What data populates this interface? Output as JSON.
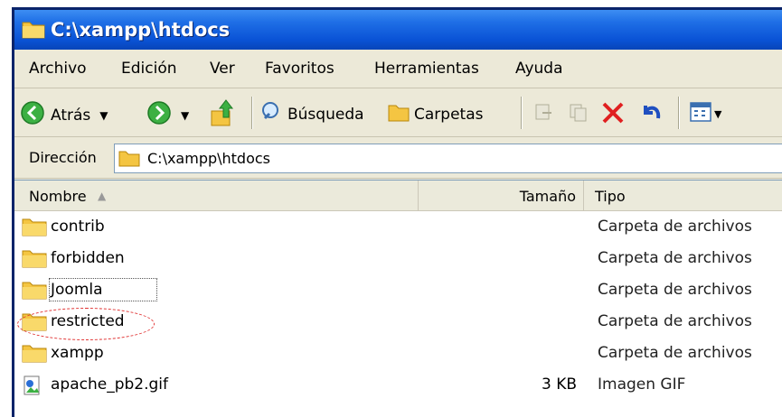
{
  "window": {
    "title": "C:\\xampp\\htdocs"
  },
  "menu": [
    {
      "label": "Archivo"
    },
    {
      "label": "Edición"
    },
    {
      "label": "Ver"
    },
    {
      "label": "Favoritos"
    },
    {
      "label": "Herramientas"
    },
    {
      "label": "Ayuda"
    }
  ],
  "toolbar": {
    "back_label": "Atrás",
    "search_label": "Búsqueda",
    "folders_label": "Carpetas"
  },
  "address": {
    "label": "Dirección",
    "value": "C:\\xampp\\htdocs"
  },
  "list": {
    "columns": {
      "name": "Nombre",
      "size": "Tamaño",
      "type": "Tipo"
    },
    "rows": [
      {
        "name": "contrib",
        "size": "",
        "type": "Carpeta de archivos"
      },
      {
        "name": "forbidden",
        "size": "",
        "type": "Carpeta de archivos"
      },
      {
        "name": "Joomla",
        "size": "",
        "type": "Carpeta de archivos"
      },
      {
        "name": "restricted",
        "size": "",
        "type": "Carpeta de archivos"
      },
      {
        "name": "xampp",
        "size": "",
        "type": "Carpeta de archivos"
      },
      {
        "name": "apache_pb2.gif",
        "size": "3 KB",
        "type": "Imagen GIF"
      }
    ]
  },
  "colors": {
    "titlebar": "#0a53d6",
    "highlight_circle": "#e03030",
    "folder": "#f4c542"
  }
}
